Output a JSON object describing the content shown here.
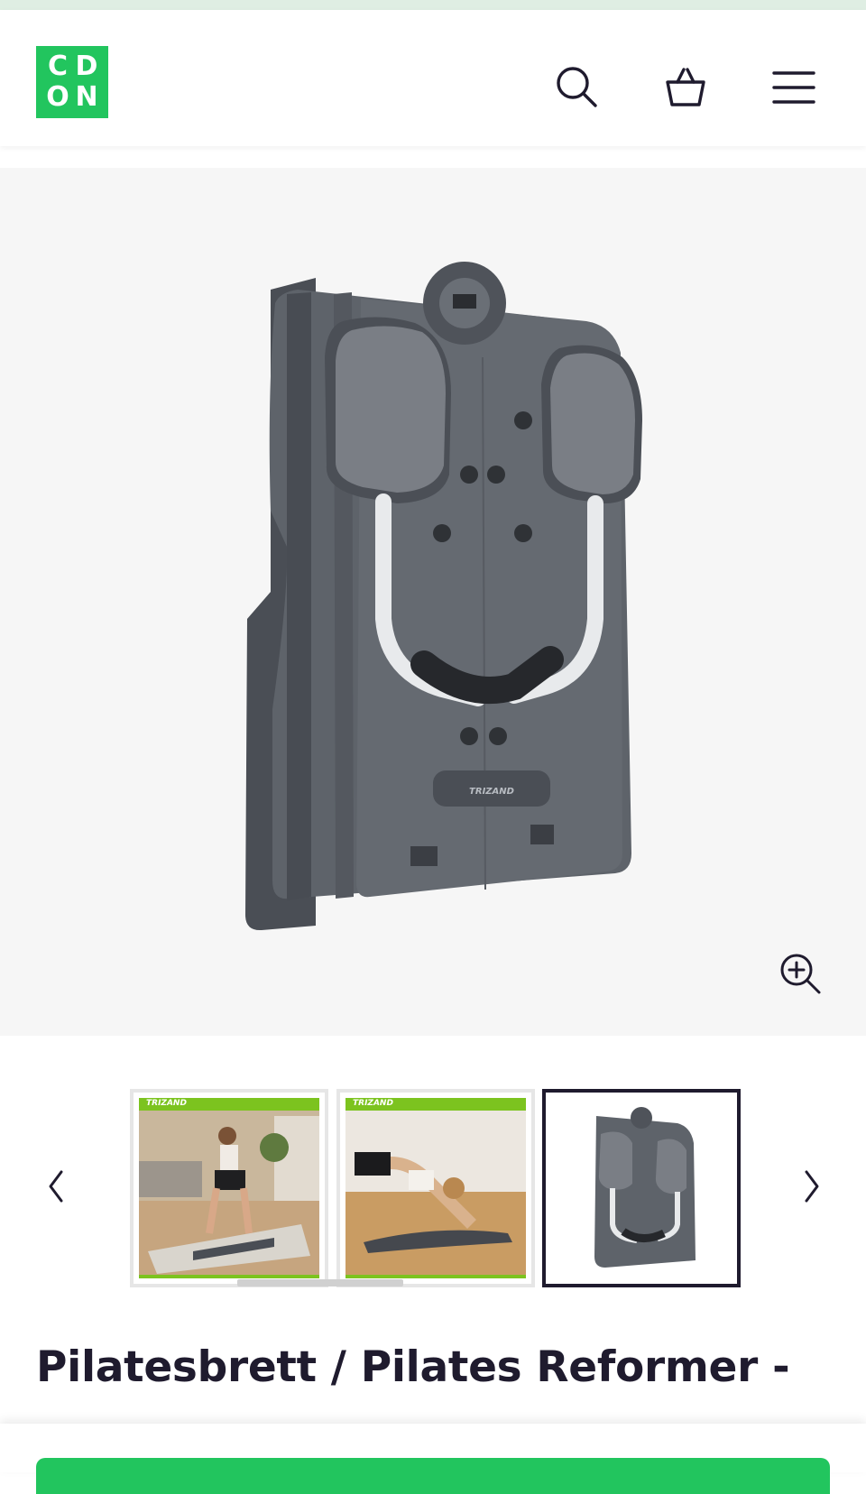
{
  "header": {
    "logo_letters": [
      "C",
      "D",
      "O",
      "N"
    ],
    "icons": [
      "search-icon",
      "basket-icon",
      "menu-icon"
    ]
  },
  "gallery": {
    "main_image_brand": "TRIZAND",
    "zoom_icon": "zoom-in-icon",
    "thumbnails": [
      {
        "brand": "TRIZAND",
        "label": "lifestyle-squat"
      },
      {
        "brand": "TRIZAND",
        "label": "lifestyle-pushup"
      },
      {
        "brand": "",
        "label": "product-board"
      }
    ],
    "active_thumbnail": 3,
    "prev_icon": "chevron-left-icon",
    "next_icon": "chevron-right-icon"
  },
  "product": {
    "title": "Pilatesbrett / Pilates Reformer -"
  },
  "colors": {
    "brand": "#22c55e",
    "text": "#1f1b2e",
    "thumb_accent": "#7cc31f"
  }
}
